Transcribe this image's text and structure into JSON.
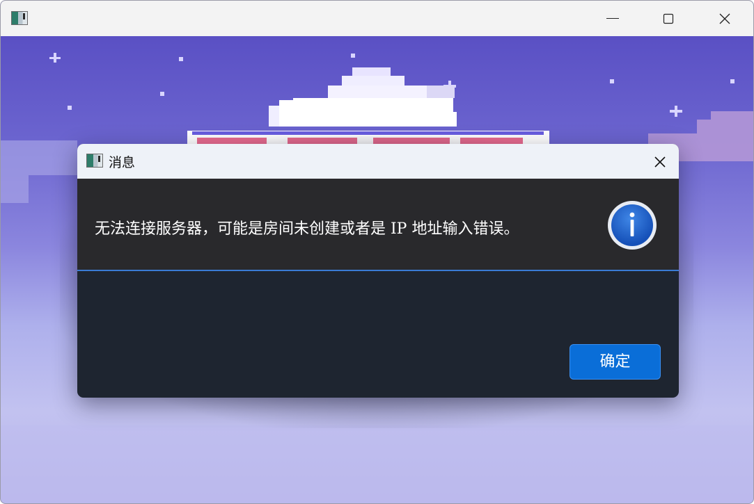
{
  "window": {
    "controls": {
      "minimize_icon": "minimize-icon",
      "maximize_icon": "maximize-icon",
      "close_icon": "close-icon"
    }
  },
  "dialog": {
    "title": "消息",
    "message": "无法连接服务器，可能是房间未创建或者是 IP 地址输入错误。",
    "icon": "info-icon",
    "ok_button": "确定"
  },
  "colors": {
    "dialog_titlebar": "#eef2f8",
    "dialog_content": "#29292c",
    "dialog_footer": "#1e2530",
    "accent": "#0a6ed8",
    "divider": "#3a7bd5",
    "info_icon": "#1a5fc8"
  }
}
